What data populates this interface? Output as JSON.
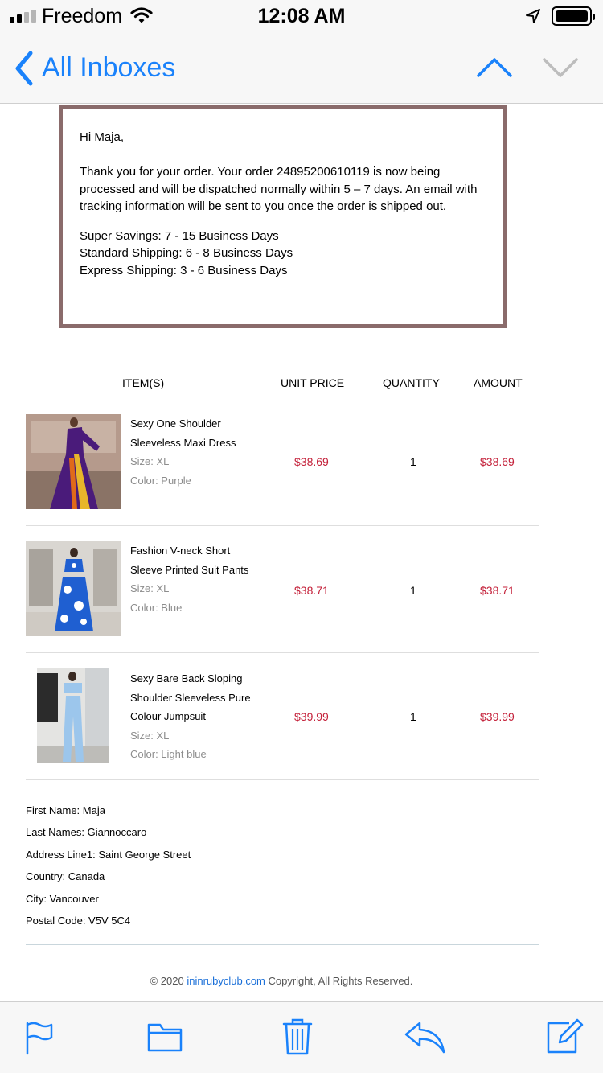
{
  "status_bar": {
    "carrier": "Freedom",
    "time": "12:08 AM"
  },
  "nav": {
    "back_label": "All Inboxes"
  },
  "message": {
    "greeting": "Hi Maja,",
    "body": "Thank you for your order. Your order 24895200610119 is now being processed and will be dispatched normally within 5 – 7 days. An email with tracking information will be sent to you once the order is shipped out.",
    "shipping": [
      "Super Savings: 7 - 15 Business Days",
      "Standard Shipping: 6 - 8 Business Days",
      "Express Shipping: 3 - 6 Business Days"
    ]
  },
  "table": {
    "headers": {
      "item": "ITEM(S)",
      "unit_price": "UNIT PRICE",
      "quantity": "QUANTITY",
      "amount": "AMOUNT"
    },
    "items": [
      {
        "name_lines": [
          "Sexy One Shoulder",
          "Sleeveless Maxi Dress"
        ],
        "size": "Size: XL",
        "color": "Color: Purple",
        "unit_price": "$38.69",
        "quantity": "1",
        "amount": "$38.69"
      },
      {
        "name_lines": [
          "Fashion V-neck Short",
          "Sleeve Printed Suit Pants"
        ],
        "size": "Size: XL",
        "color": "Color: Blue",
        "unit_price": "$38.71",
        "quantity": "1",
        "amount": "$38.71"
      },
      {
        "name_lines": [
          "Sexy Bare Back Sloping",
          "Shoulder Sleeveless Pure",
          "Colour Jumpsuit"
        ],
        "size": "Size: XL",
        "color": "Color: Light blue",
        "unit_price": "$39.99",
        "quantity": "1",
        "amount": "$39.99"
      }
    ]
  },
  "address": {
    "first_name": "First Name: Maja",
    "last_names": "Last Names: Giannoccaro",
    "address_line1": "Address Line1: Saint George Street",
    "country": "Country: Canada",
    "city": "City: Vancouver",
    "postal_code": "Postal Code: V5V 5C4"
  },
  "footer": {
    "prefix": "© 2020 ",
    "link": "ininrubyclub.com",
    "suffix": " Copyright, All Rights Reserved."
  },
  "toolbar": {
    "icons": [
      "flag-icon",
      "folder-icon",
      "trash-icon",
      "reply-icon",
      "compose-icon"
    ]
  },
  "colors": {
    "accent": "#1a82fb",
    "price": "#c4213a",
    "box_border": "#8a6b6b"
  }
}
